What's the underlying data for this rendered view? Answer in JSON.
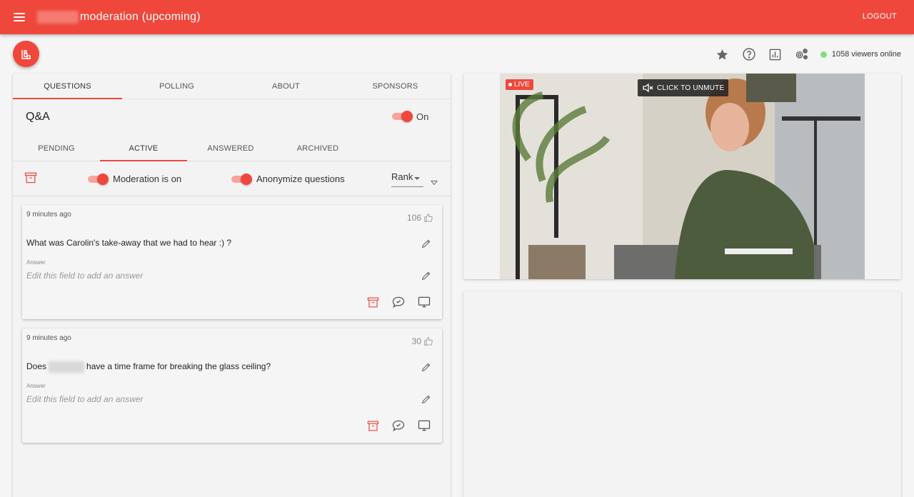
{
  "header": {
    "title": "moderation (upcoming)",
    "logout_label": "LOGOUT"
  },
  "toolbar": {
    "icons": [
      "star-icon",
      "help-icon",
      "analytics-icon",
      "settings-icon"
    ],
    "viewers_online": "1058 viewers online"
  },
  "left_panel": {
    "tabs": [
      {
        "label": "QUESTIONS",
        "active": true
      },
      {
        "label": "POLLING",
        "active": false
      },
      {
        "label": "ABOUT",
        "active": false
      },
      {
        "label": "SPONSORS",
        "active": false
      }
    ],
    "qa_title": "Q&A",
    "qa_toggle_label": "On",
    "subtabs": [
      {
        "label": "PENDING",
        "active": false
      },
      {
        "label": "ACTIVE",
        "active": true
      },
      {
        "label": "ANSWERED",
        "active": false
      },
      {
        "label": "ARCHIVED",
        "active": false
      }
    ],
    "moderation_label": "Moderation is on",
    "anonymize_label": "Anonymize questions",
    "sort_value": "Rank",
    "questions": [
      {
        "time": "9 minutes ago",
        "votes": "106",
        "text": "What was Carolin's take-away that we had to hear :) ?",
        "answer_label": "Answer",
        "answer_placeholder": "Edit this field to add an answer"
      },
      {
        "time": "9 minutes ago",
        "votes": "30",
        "text_before": "Does",
        "text_after": "have a time frame for breaking the glass ceiling?",
        "answer_label": "Answer",
        "answer_placeholder": "Edit this field to add an answer"
      }
    ]
  },
  "video": {
    "live_label": "LIVE",
    "unmute_label": "CLICK TO UNMUTE"
  },
  "colors": {
    "accent": "#f0473c",
    "online": "#7ee07e"
  }
}
